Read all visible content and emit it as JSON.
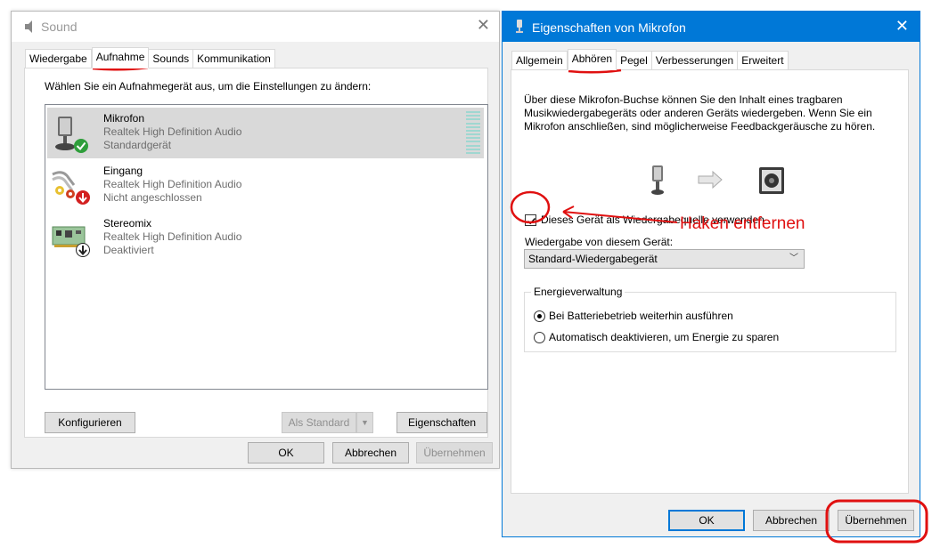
{
  "sound_window": {
    "title": "Sound",
    "close_glyph": "✕",
    "tabs": [
      "Wiedergabe",
      "Aufnahme",
      "Sounds",
      "Kommunikation"
    ],
    "active_tab": "Aufnahme",
    "instruction": "Wählen Sie ein Aufnahmegerät aus, um die Einstellungen zu ändern:",
    "devices": [
      {
        "name": "Mikrofon",
        "driver": "Realtek High Definition Audio",
        "status": "Standardgerät",
        "icon": "microphone-icon",
        "badge": "green-check-badge",
        "selected": true
      },
      {
        "name": "Eingang",
        "driver": "Realtek High Definition Audio",
        "status": "Nicht angeschlossen",
        "icon": "cable-jack-icon",
        "badge": "red-down-arrow-badge",
        "selected": false
      },
      {
        "name": "Stereomix",
        "driver": "Realtek High Definition Audio",
        "status": "Deaktiviert",
        "icon": "sound-card-icon",
        "badge": "black-down-arrow-badge",
        "selected": false
      }
    ],
    "buttons": {
      "configure": "Konfigurieren",
      "set_default": "Als Standard",
      "properties": "Eigenschaften",
      "ok": "OK",
      "cancel": "Abbrechen",
      "apply": "Übernehmen"
    }
  },
  "props_window": {
    "title": "Eigenschaften von Mikrofon",
    "close_glyph": "✕",
    "tabs": [
      "Allgemein",
      "Abhören",
      "Pegel",
      "Verbesserungen",
      "Erweitert"
    ],
    "active_tab": "Abhören",
    "description": "Über diese Mikrofon-Buchse können Sie den Inhalt eines tragbaren Musikwiedergabegeräts oder anderen Geräts wiedergeben. Wenn Sie ein Mikrofon anschließen, sind möglicherweise Feedbackgeräusche zu hören.",
    "listen_checkbox_label": "Dieses Gerät als Wiedergabequelle verwenden",
    "listen_checked": true,
    "playback_label": "Wiedergabe von diesem Gerät:",
    "playback_select_value": "Standard-Wiedergabegerät",
    "power_group_title": "Energieverwaltung",
    "power_options": [
      {
        "label": "Bei Batteriebetrieb weiterhin ausführen",
        "selected": true
      },
      {
        "label": "Automatisch deaktivieren, um Energie zu sparen",
        "selected": false
      }
    ],
    "buttons": {
      "ok": "OK",
      "cancel": "Abbrechen",
      "apply": "Übernehmen"
    }
  },
  "annotation": {
    "text": "Haken entfernen",
    "color": "#e01010"
  },
  "colors": {
    "accent": "#0078d7",
    "selected_row": "#d9d9d9",
    "annotation_red": "#e01010"
  }
}
